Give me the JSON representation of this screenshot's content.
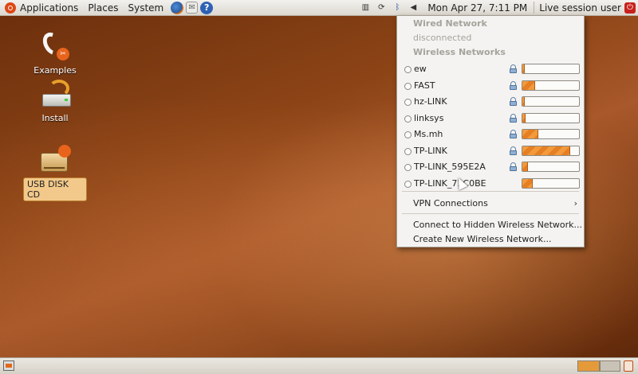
{
  "top_panel": {
    "menus": [
      "Applications",
      "Places",
      "System"
    ],
    "launchers": [
      "firefox-icon",
      "mail-icon",
      "help-icon"
    ],
    "tray_icons": [
      "network-manager-icon",
      "update-notifier-icon",
      "bluetooth-icon",
      "volume-icon"
    ],
    "clock": "Mon Apr 27,  7:11 PM",
    "session_label": "Live session user"
  },
  "desktop": {
    "icons": [
      {
        "label": "Examples",
        "icon": "examples-icon"
      },
      {
        "label": "Install",
        "icon": "install-icon"
      },
      {
        "label": "USB DISK CD",
        "icon": "usb-disk-icon",
        "selected": true
      }
    ]
  },
  "network_menu": {
    "wired_header": "Wired Network",
    "wired_status": "disconnected",
    "wireless_header": "Wireless Networks",
    "networks": [
      {
        "name": "ew",
        "secured": true,
        "signal": 0.04
      },
      {
        "name": "FAST",
        "secured": true,
        "signal": 0.22
      },
      {
        "name": "hz-LINK",
        "secured": true,
        "signal": 0.04
      },
      {
        "name": "linksys",
        "secured": true,
        "signal": 0.06
      },
      {
        "name": "Ms.mh",
        "secured": true,
        "signal": 0.28
      },
      {
        "name": "TP-LINK",
        "secured": true,
        "signal": 0.85
      },
      {
        "name": "TP-LINK_595E2A",
        "secured": true,
        "signal": 0.1
      },
      {
        "name": "TP-LINK_71C0BE",
        "secured": false,
        "signal": 0.18
      }
    ],
    "vpn_label": "VPN Connections",
    "connect_hidden_label": "Connect to Hidden Wireless Network...",
    "create_new_label": "Create New Wireless Network..."
  },
  "colors": {
    "accent": "#e57f24",
    "panel": "#dcd8d0",
    "desktop": "#8c4416"
  }
}
